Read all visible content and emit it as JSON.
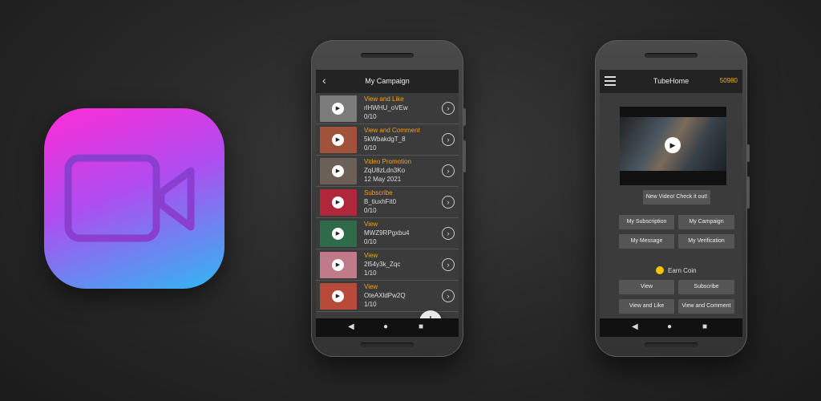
{
  "colors": {
    "accent": "#f0a11c",
    "coin": "#f0b21a",
    "icon_gradient": [
      "#ff2bd6",
      "#b04cf0",
      "#2fb8f2"
    ],
    "icon_glyph": "#8a3fd0"
  },
  "app_icon": {
    "icon": "video-camera-icon"
  },
  "campaign_screen": {
    "title": "My Campaign",
    "back_icon": "chevron-left-icon",
    "rows": [
      {
        "type": "View and Like",
        "id": "rlHWHU_oVEw",
        "progress": "0/10",
        "thumb_color": "#7c7c7c"
      },
      {
        "type": "View and Comment",
        "id": "5kWbakdgT_8",
        "progress": "0/10",
        "thumb_color": "#a0523a"
      },
      {
        "type": "Video Promotion",
        "id": "ZqU8zLdn3Ko",
        "progress": "12 May 2021",
        "thumb_color": "#6a6058"
      },
      {
        "type": "Subscribe",
        "id": "B_tiuxhFit0",
        "progress": "0/10",
        "thumb_color": "#b0263a"
      },
      {
        "type": "View",
        "id": "MWZ9RPgxbu4",
        "progress": "0/10",
        "thumb_color": "#2f6a4a"
      },
      {
        "type": "View",
        "id": "2l54y3k_Zqc",
        "progress": "1/10",
        "thumb_color": "#c07a8a"
      },
      {
        "type": "View",
        "id": "OteAXldPw2Q",
        "progress": "1/10",
        "thumb_color": "#b84a3a"
      }
    ],
    "fab_label": "+"
  },
  "home_screen": {
    "title": "TubeHome",
    "coins": "50980",
    "new_video_button": "New Video! Check it out!",
    "menu_buttons": [
      "My Subscription",
      "My Campaign",
      "My Message",
      "My Verification"
    ],
    "earn_coin_label": "Earn Coin",
    "earn_buttons": [
      "View",
      "Subscribe",
      "View and Like",
      "View and Comment"
    ]
  },
  "nav": {
    "back": "◀",
    "home": "●",
    "recent": "■"
  }
}
